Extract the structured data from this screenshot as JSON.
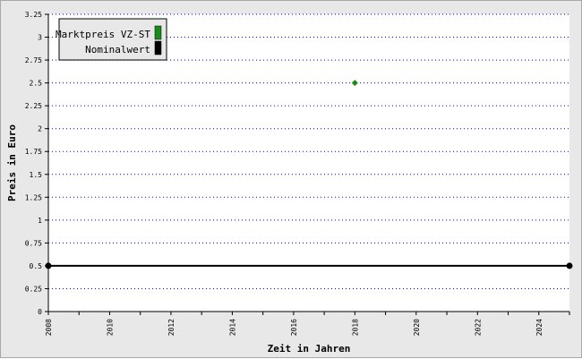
{
  "chart_data": {
    "type": "line",
    "xlabel": "Zeit in Jahren",
    "ylabel": "Preis in Euro",
    "xlim": [
      2008,
      2025
    ],
    "ylim": [
      0,
      3.25
    ],
    "x_ticks": [
      2008,
      2010,
      2012,
      2014,
      2016,
      2018,
      2020,
      2022,
      2024
    ],
    "y_ticks": [
      0,
      0.25,
      0.5,
      0.75,
      1,
      1.25,
      1.5,
      1.75,
      2,
      2.25,
      2.5,
      2.75,
      3,
      3.25
    ],
    "y_tick_labels": [
      "0",
      "0.25",
      "0.5",
      "0.75",
      "1",
      "1.25",
      "1.5",
      "1.75",
      "2",
      "2.25",
      "2.5",
      "2.75",
      "3",
      "3.25"
    ],
    "grid": "horizontal, dotted",
    "legend_position": "top-left",
    "series": [
      {
        "name": "Marktpreis VZ-ST",
        "color": "#1a8a1a",
        "marker": "diamond",
        "points": [
          [
            2018,
            2.5
          ]
        ]
      },
      {
        "name": "Nominalwert",
        "color": "#000000",
        "marker": "circle",
        "points": [
          [
            2008,
            0.5
          ],
          [
            2025,
            0.5
          ]
        ]
      }
    ]
  }
}
